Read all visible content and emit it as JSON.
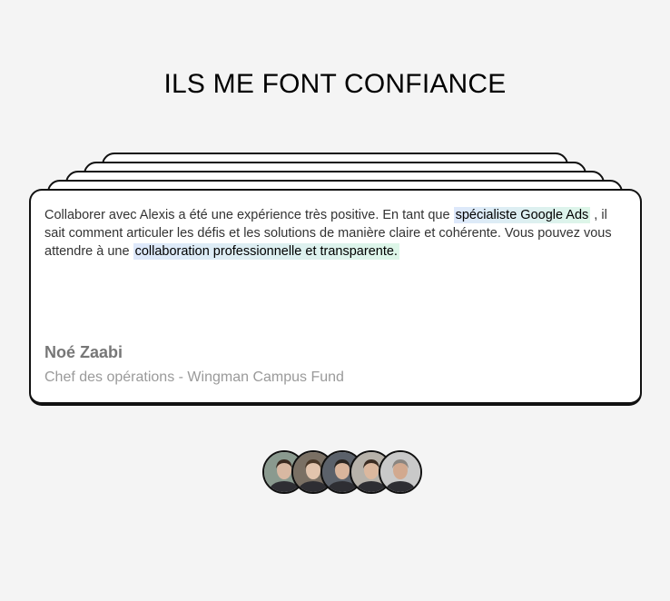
{
  "section": {
    "title": "ILS ME FONT CONFIANCE"
  },
  "testimonial": {
    "quote_part1": "Collaborer avec Alexis a été une expérience très positive. En tant que ",
    "highlight1": "spécialiste Google Ads",
    "quote_part2": " , il sait comment articuler les défis et les solutions de manière claire et cohérente. Vous pouvez vous attendre à une ",
    "highlight2": "collaboration professionnelle et transparente.",
    "author_name": "Noé Zaabi",
    "author_role": "Chef des opérations - Wingman Campus Fund"
  },
  "avatars": [
    {
      "name": "avatar-1",
      "bg": "#8a9a8f",
      "skin": "#d8b8a2",
      "hair": "#3a2a20"
    },
    {
      "name": "avatar-2",
      "bg": "#7a7064",
      "skin": "#e2c4ad",
      "hair": "#4a3828"
    },
    {
      "name": "avatar-3",
      "bg": "#5b616a",
      "skin": "#d9b59c",
      "hair": "#2a2420"
    },
    {
      "name": "avatar-4",
      "bg": "#b7b2aa",
      "skin": "#dcb89e",
      "hair": "#3b2c22"
    },
    {
      "name": "avatar-5",
      "bg": "#c9c9c9",
      "skin": "#d2a98f",
      "hair": "#8a8580"
    }
  ]
}
